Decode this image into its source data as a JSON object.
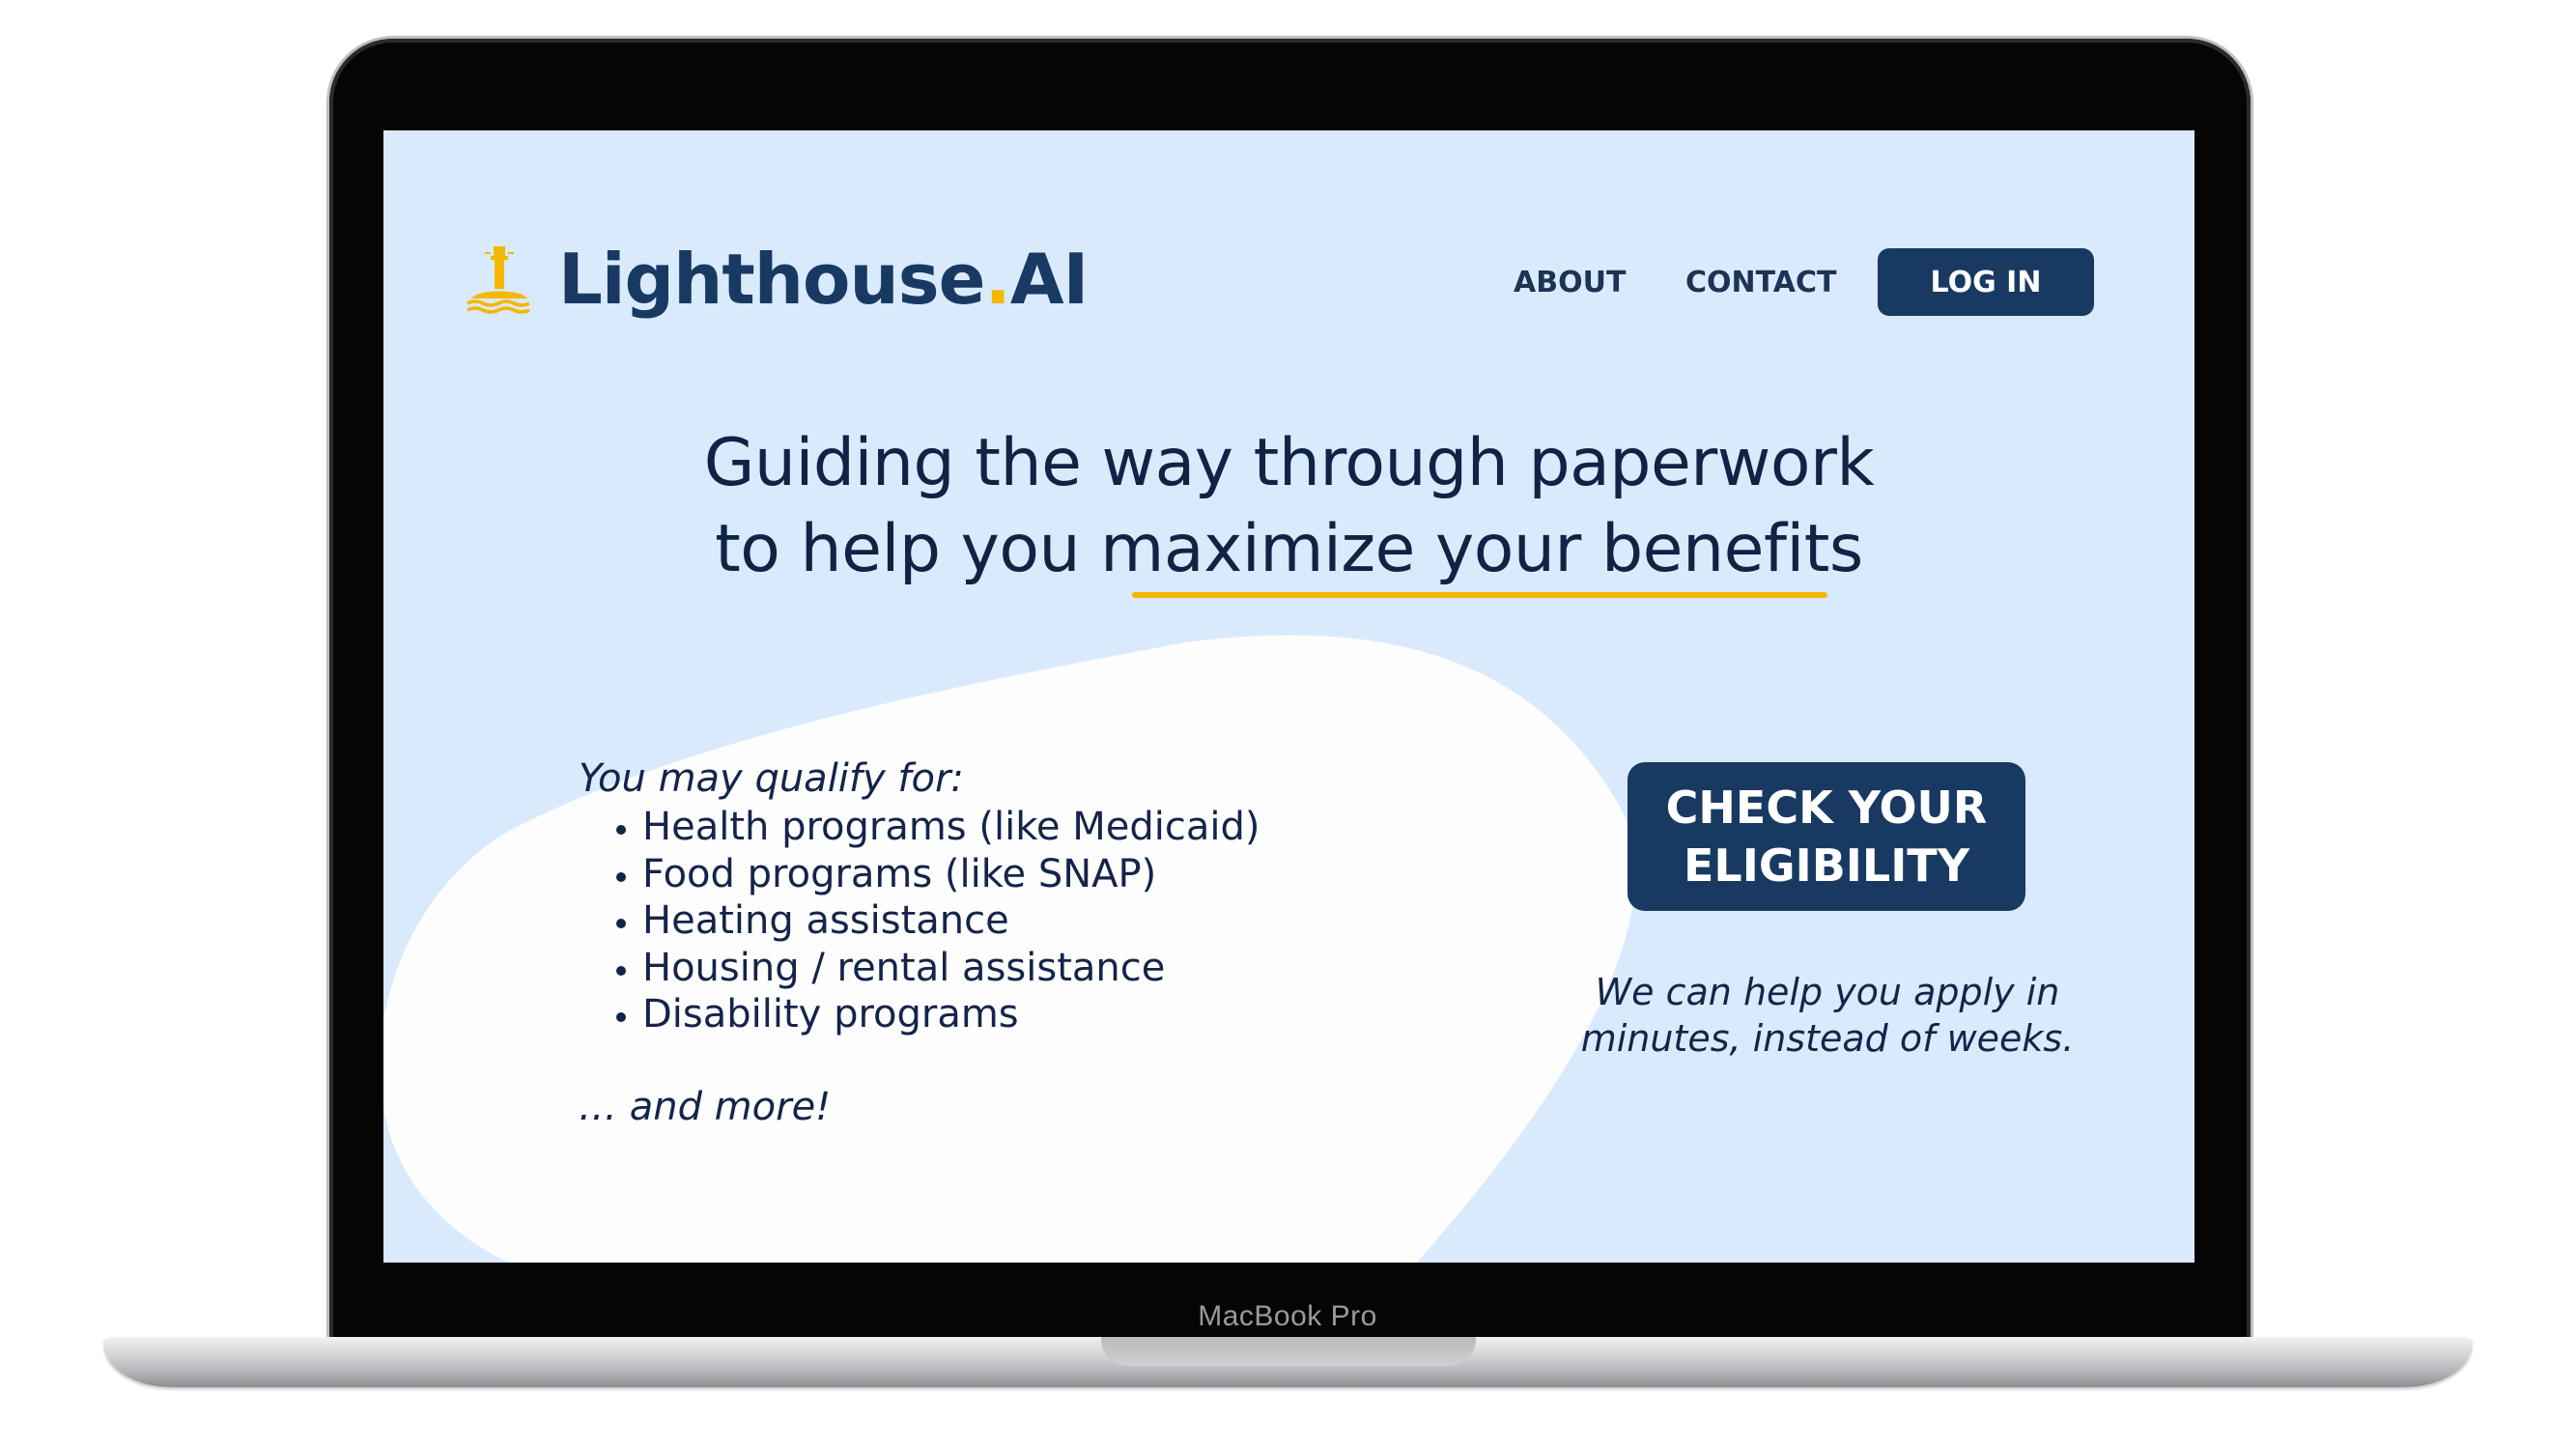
{
  "device": {
    "label": "MacBook Pro"
  },
  "header": {
    "logo": {
      "icon": "lighthouse-icon",
      "name_main": "Lighthouse",
      "name_dot": ".",
      "name_suffix": "AI"
    },
    "nav": {
      "about": "ABOUT",
      "contact": "CONTACT",
      "login": "LOG IN"
    }
  },
  "hero": {
    "line1": "Guiding the way through paperwork",
    "line2": "to help you maximize your benefits"
  },
  "qualify": {
    "intro": "You may qualify for:",
    "items": [
      "Health programs (like Medicaid)",
      "Food programs (like SNAP)",
      "Heating assistance",
      "Housing / rental assistance",
      "Disability programs"
    ],
    "more": "… and more!"
  },
  "cta": {
    "button_line1": "CHECK YOUR",
    "button_line2": "ELIGIBILITY",
    "subtext_line1": "We can help you apply in",
    "subtext_line2": "minutes, instead of weeks."
  },
  "colors": {
    "background": "#d9eafc",
    "primary": "#183a62",
    "accent": "#f5b700",
    "text": "#0f2345",
    "blob": "#fdfdfd"
  }
}
